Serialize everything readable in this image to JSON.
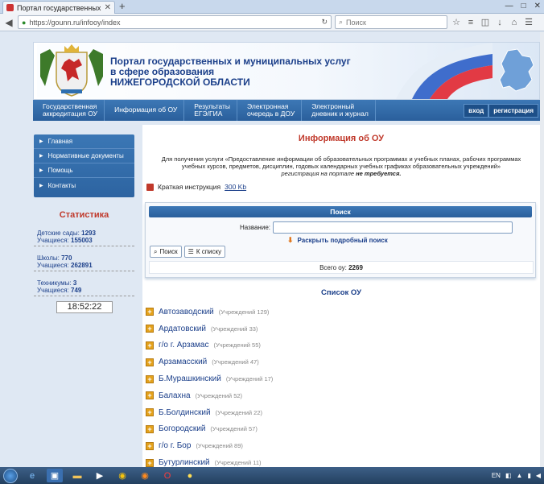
{
  "browser": {
    "tab_title": "Портал государственных и...",
    "url": "https://gounn.ru/infooy/index",
    "search_placeholder": "Поиск"
  },
  "header": {
    "title_line1": "Портал государственных и муниципальных услуг",
    "title_line2": "в сфере образования",
    "title_line3": "НИЖЕГОРОДСКОЙ ОБЛАСТИ"
  },
  "menu": [
    {
      "label1": "Государственная",
      "label2": "аккредитация ОУ"
    },
    {
      "label1": "Информация об ОУ",
      "label2": ""
    },
    {
      "label1": "Результаты",
      "label2": "ЕГЭ/ГИА"
    },
    {
      "label1": "Электронная",
      "label2": "очередь в ДОУ"
    },
    {
      "label1": "Электронный",
      "label2": "дневник и журнал"
    }
  ],
  "login": {
    "enter": "вход",
    "register": "регистрация"
  },
  "sidebar": {
    "items": [
      "Главная",
      "Нормативные документы",
      "Помощь",
      "Контакты"
    ]
  },
  "stats": {
    "title": "Статистика",
    "kindergartens_label": "Детские сады:",
    "kindergartens": "1293",
    "k_students_label": "Учащиеся:",
    "k_students": "155003",
    "schools_label": "Школы:",
    "schools": "770",
    "s_students_label": "Учащиеся:",
    "s_students": "262891",
    "colleges_label": "Техникумы:",
    "colleges": "3",
    "c_students_label": "Учащиеся:",
    "c_students": "749",
    "clock": "18:52:22"
  },
  "main": {
    "title": "Информация об ОУ",
    "desc1": "Для получения услуги «Предоставление информации об образовательных программах и учебных планах, рабочих программах",
    "desc2": "учебных курсов, предметов, дисциплин, годовых календарных учебных графиках образовательных учреждений»",
    "desc3_prefix": "регистрация на портале",
    "desc3_bold": "не требуется.",
    "instr_label": "Краткая инструкция",
    "instr_link": "300 Kb"
  },
  "search": {
    "header": "Поиск",
    "name_label": "Название:",
    "advanced": "Раскрыть подробный поиск",
    "btn_search": "Поиск",
    "btn_list": "К списку",
    "total_label": "Всего оу:",
    "total": "2269"
  },
  "list": {
    "title": "Список ОУ",
    "districts": [
      {
        "name": "Автозаводский",
        "count": "(Учреждений 129)"
      },
      {
        "name": "Ардатовский",
        "count": "(Учреждений 33)"
      },
      {
        "name": "г/о г. Арзамас",
        "count": "(Учреждений 55)"
      },
      {
        "name": "Арзамасский",
        "count": "(Учреждений 47)"
      },
      {
        "name": "Б.Мурашкинский",
        "count": "(Учреждений 17)"
      },
      {
        "name": "Балахна",
        "count": "(Учреждений 52)"
      },
      {
        "name": "Б.Болдинский",
        "count": "(Учреждений 22)"
      },
      {
        "name": "Богородский",
        "count": "(Учреждений 57)"
      },
      {
        "name": "г/о г. Бор",
        "count": "(Учреждений 89)"
      },
      {
        "name": "Бутурлинский",
        "count": "(Учреждений 11)"
      }
    ]
  },
  "taskbar": {
    "lang": "EN"
  }
}
